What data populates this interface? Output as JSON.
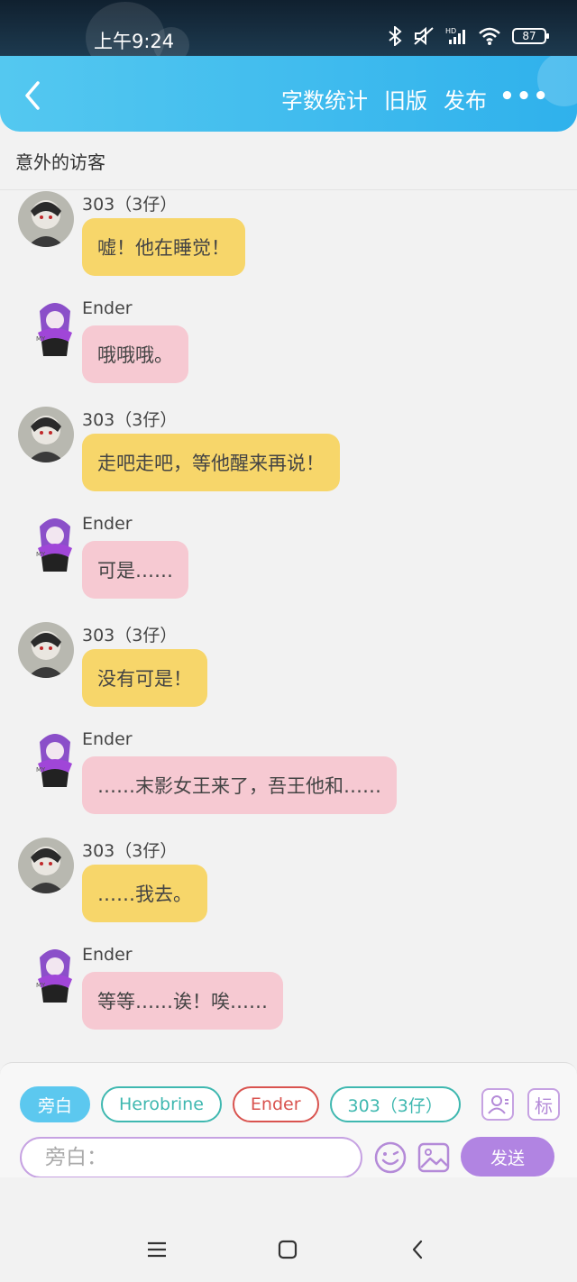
{
  "status_bar": {
    "time": "上午9:24",
    "battery": "87"
  },
  "header": {
    "actions": [
      "字数统计",
      "旧版",
      "发布"
    ]
  },
  "chapter_title": "意外的访客",
  "messages": [
    {
      "sender": "303（3仔）",
      "text": "嘘！他在睡觉！",
      "color": "#f7d66a"
    },
    {
      "sender": "Ender",
      "text": "哦哦哦。",
      "color": "#f6c9d2"
    },
    {
      "sender": "303（3仔）",
      "text": "走吧走吧，等他醒来再说！",
      "color": "#f7d66a"
    },
    {
      "sender": "Ender",
      "text": "可是……",
      "color": "#f6c9d2"
    },
    {
      "sender": "303（3仔）",
      "text": "没有可是！",
      "color": "#f7d66a"
    },
    {
      "sender": "Ender",
      "text": "……末影女王来了，吾王他和……",
      "color": "#f6c9d2"
    },
    {
      "sender": "303（3仔）",
      "text": "……我去。",
      "color": "#f7d66a"
    },
    {
      "sender": "Ender",
      "text": "等等……诶！唉……",
      "color": "#f6c9d2"
    }
  ],
  "composer": {
    "characters": [
      "旁白",
      "Herobrine",
      "Ender",
      "303（3仔）"
    ],
    "selected": "旁白",
    "tool_label": "标",
    "placeholder": "旁白：",
    "send_label": "发送"
  },
  "colors": {
    "accent": "#2fb1ec",
    "purple": "#b184e2"
  }
}
